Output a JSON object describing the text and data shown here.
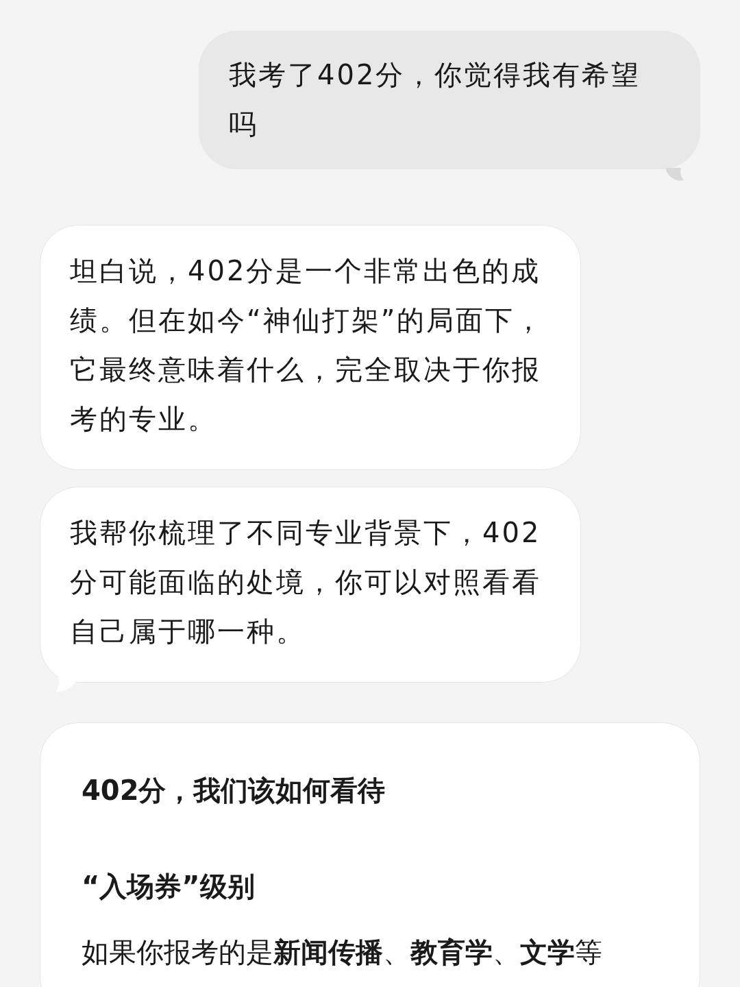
{
  "messages": [
    {
      "kind": "sent",
      "text": "我考了402分，你觉得我有希望吗",
      "tail": true
    },
    {
      "kind": "received",
      "text": "坦白说，402分是一个非常出色的成绩。但在如今“神仙打架”的局面下，它最终意味着什么，完全取决于你报考的专业。",
      "tail": false
    },
    {
      "kind": "received",
      "text": "我帮你梳理了不同专业背景下，402分可能面临的处境，你可以对照看看自己属于哪一种。",
      "tail": true
    }
  ],
  "card": {
    "title": "402分，我们该如何看待",
    "sections": [
      {
        "heading": "“入场券”级别",
        "body": "如果你报考的是**新闻传播**、**教育学**、**文学**等"
      }
    ]
  }
}
